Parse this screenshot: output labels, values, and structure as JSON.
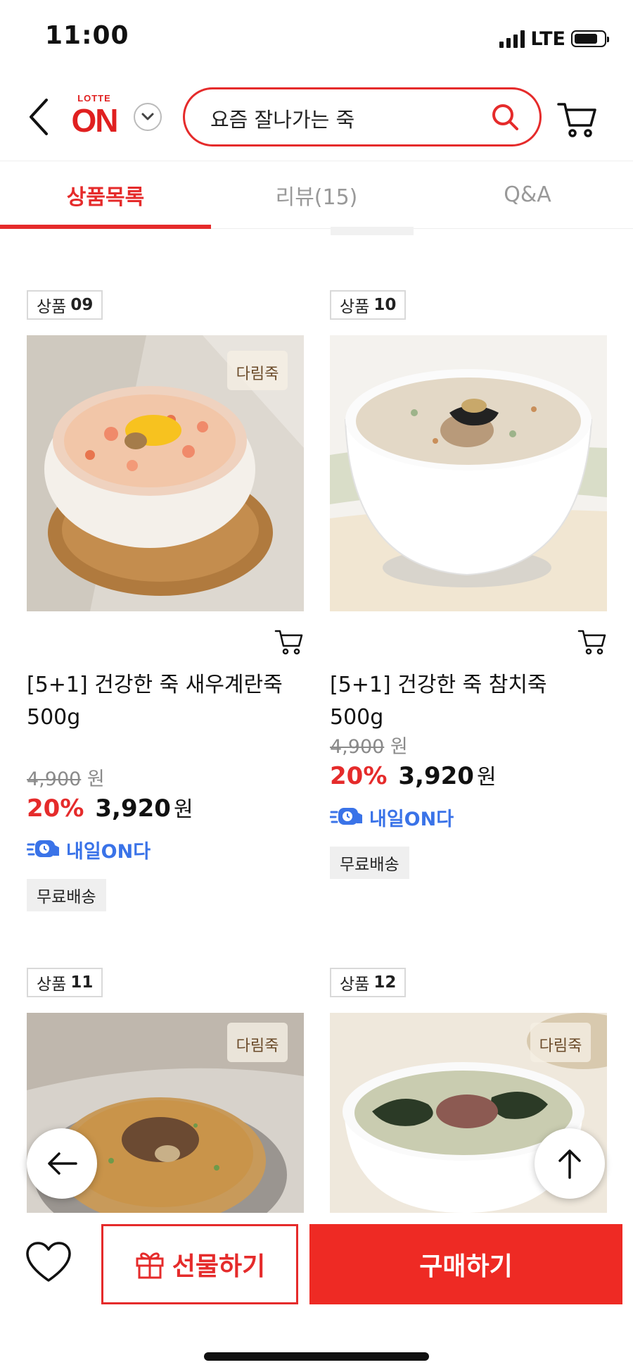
{
  "status": {
    "time": "11:00",
    "network": "LTE"
  },
  "header": {
    "logo_top": "LOTTE",
    "logo_main": "ON",
    "search_value": "요즘 잘나가는 죽"
  },
  "tabs": [
    {
      "label": "상품목록",
      "active": true
    },
    {
      "label": "리뷰(15)",
      "active": false
    },
    {
      "label": "Q&A",
      "active": false
    }
  ],
  "products": [
    {
      "badge_prefix": "상품",
      "badge_num": "09",
      "title": "[5+1] 건강한 죽 새우계란죽 500g",
      "original_price": "4,900",
      "currency": "원",
      "discount": "20%",
      "sale_price": "3,920",
      "delivery": "내일ON다",
      "shipping": "무료배송"
    },
    {
      "badge_prefix": "상품",
      "badge_num": "10",
      "title": "[5+1] 건강한 죽 참치죽 500g",
      "original_price": "4,900",
      "currency": "원",
      "discount": "20%",
      "sale_price": "3,920",
      "delivery": "내일ON다",
      "shipping": "무료배송"
    },
    {
      "badge_prefix": "상품",
      "badge_num": "11"
    },
    {
      "badge_prefix": "상품",
      "badge_num": "12"
    }
  ],
  "bottom": {
    "gift_label": "선물하기",
    "buy_label": "구매하기"
  },
  "colors": {
    "accent": "#e52b2b",
    "buy": "#ee2a24",
    "delivery_blue": "#3a73e8"
  }
}
